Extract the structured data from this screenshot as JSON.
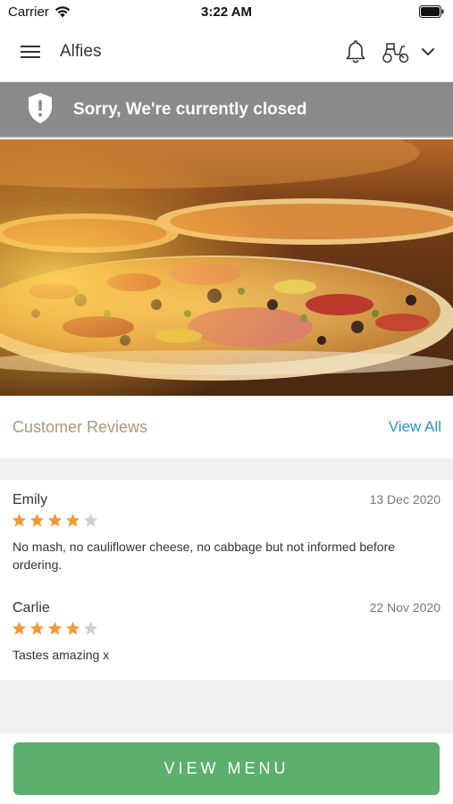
{
  "status_bar": {
    "carrier": "Carrier",
    "time": "3:22 AM"
  },
  "header": {
    "title": "Alfies",
    "icons": [
      "menu-icon",
      "bell-icon",
      "scooter-icon",
      "chevron-down-icon"
    ]
  },
  "banner": {
    "message": "Sorry, We're currently closed",
    "icon": "shield-alert-icon",
    "background": "#8a8a8a"
  },
  "reviews": {
    "title": "Customer Reviews",
    "view_all": "View All",
    "items": [
      {
        "name": "Emily",
        "date": "13 Dec 2020",
        "rating": 4,
        "max_rating": 5,
        "text": "No mash, no cauliflower cheese, no cabbage but not informed before ordering."
      },
      {
        "name": "Carlie",
        "date": "22 Nov 2020",
        "rating": 4,
        "max_rating": 5,
        "text": "Tastes amazing x"
      }
    ]
  },
  "actions": {
    "view_menu": "VIEW MENU"
  },
  "colors": {
    "accent_green": "#5caf6c",
    "link_blue": "#2a93c7",
    "star_active": "#f09a36",
    "star_inactive": "#cfcfcf",
    "section_title": "#a79a7a"
  }
}
